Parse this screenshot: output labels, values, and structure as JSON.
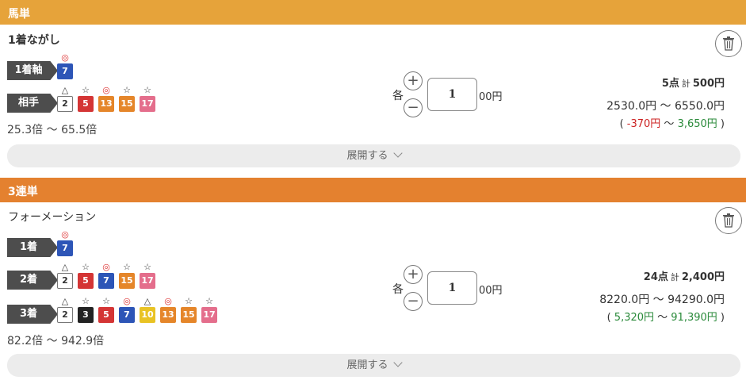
{
  "bets": [
    {
      "title": "馬単",
      "bet_type": "1着ながし",
      "rows": [
        {
          "label": "1着軸",
          "horses": [
            {
              "mark": "◎",
              "num": "7"
            }
          ]
        },
        {
          "label": "相手",
          "horses": [
            {
              "mark": "△",
              "num": "2"
            },
            {
              "mark": "☆",
              "num": "5"
            },
            {
              "mark": "◎",
              "num": "13"
            },
            {
              "mark": "☆",
              "num": "15"
            },
            {
              "mark": "☆",
              "num": "17"
            }
          ]
        }
      ],
      "odds_range": "25.3倍 〜 65.5倍",
      "each_label": "各",
      "amount": "1",
      "unit": "00円",
      "points": "5点",
      "kei": "計",
      "total": "500円",
      "payout_range": "2530.0円 〜 6550.0円",
      "profit_open": "( ",
      "profit_low": "-370円",
      "profit_sep": " 〜 ",
      "profit_high": "3,650円",
      "profit_close": " )",
      "expand_label": "展開する"
    },
    {
      "title": "3連単",
      "bet_type": "フォーメーション",
      "rows": [
        {
          "label": "1着",
          "horses": [
            {
              "mark": "◎",
              "num": "7"
            }
          ]
        },
        {
          "label": "2着",
          "horses": [
            {
              "mark": "△",
              "num": "2"
            },
            {
              "mark": "☆",
              "num": "5"
            },
            {
              "mark": "◎",
              "num": "7"
            },
            {
              "mark": "☆",
              "num": "15"
            },
            {
              "mark": "☆",
              "num": "17"
            }
          ]
        },
        {
          "label": "3着",
          "horses": [
            {
              "mark": "△",
              "num": "2"
            },
            {
              "mark": "☆",
              "num": "3"
            },
            {
              "mark": "☆",
              "num": "5"
            },
            {
              "mark": "◎",
              "num": "7"
            },
            {
              "mark": "△",
              "num": "10"
            },
            {
              "mark": "◎",
              "num": "13"
            },
            {
              "mark": "☆",
              "num": "15"
            },
            {
              "mark": "☆",
              "num": "17"
            }
          ]
        }
      ],
      "odds_range": "82.2倍 〜 942.9倍",
      "each_label": "各",
      "amount": "1",
      "unit": "00円",
      "points": "24点",
      "kei": "計",
      "total": "2,400円",
      "payout_range": "8220.0円 〜 94290.0円",
      "profit_open": "( ",
      "profit_low": "5,320円",
      "profit_sep": " 〜 ",
      "profit_high": "91,390円",
      "profit_close": " )",
      "expand_label": "展開する"
    }
  ],
  "icons": {
    "plus": "+",
    "minus": "−",
    "trash": "trash-icon",
    "chevron": "chevron-down-icon"
  },
  "colors": {
    "umatan_header": "#e6a33a",
    "sanrentan_header": "#e4812f",
    "honmei_mark": "#d33",
    "negative": "#c22",
    "positive": "#2a8a3a"
  }
}
